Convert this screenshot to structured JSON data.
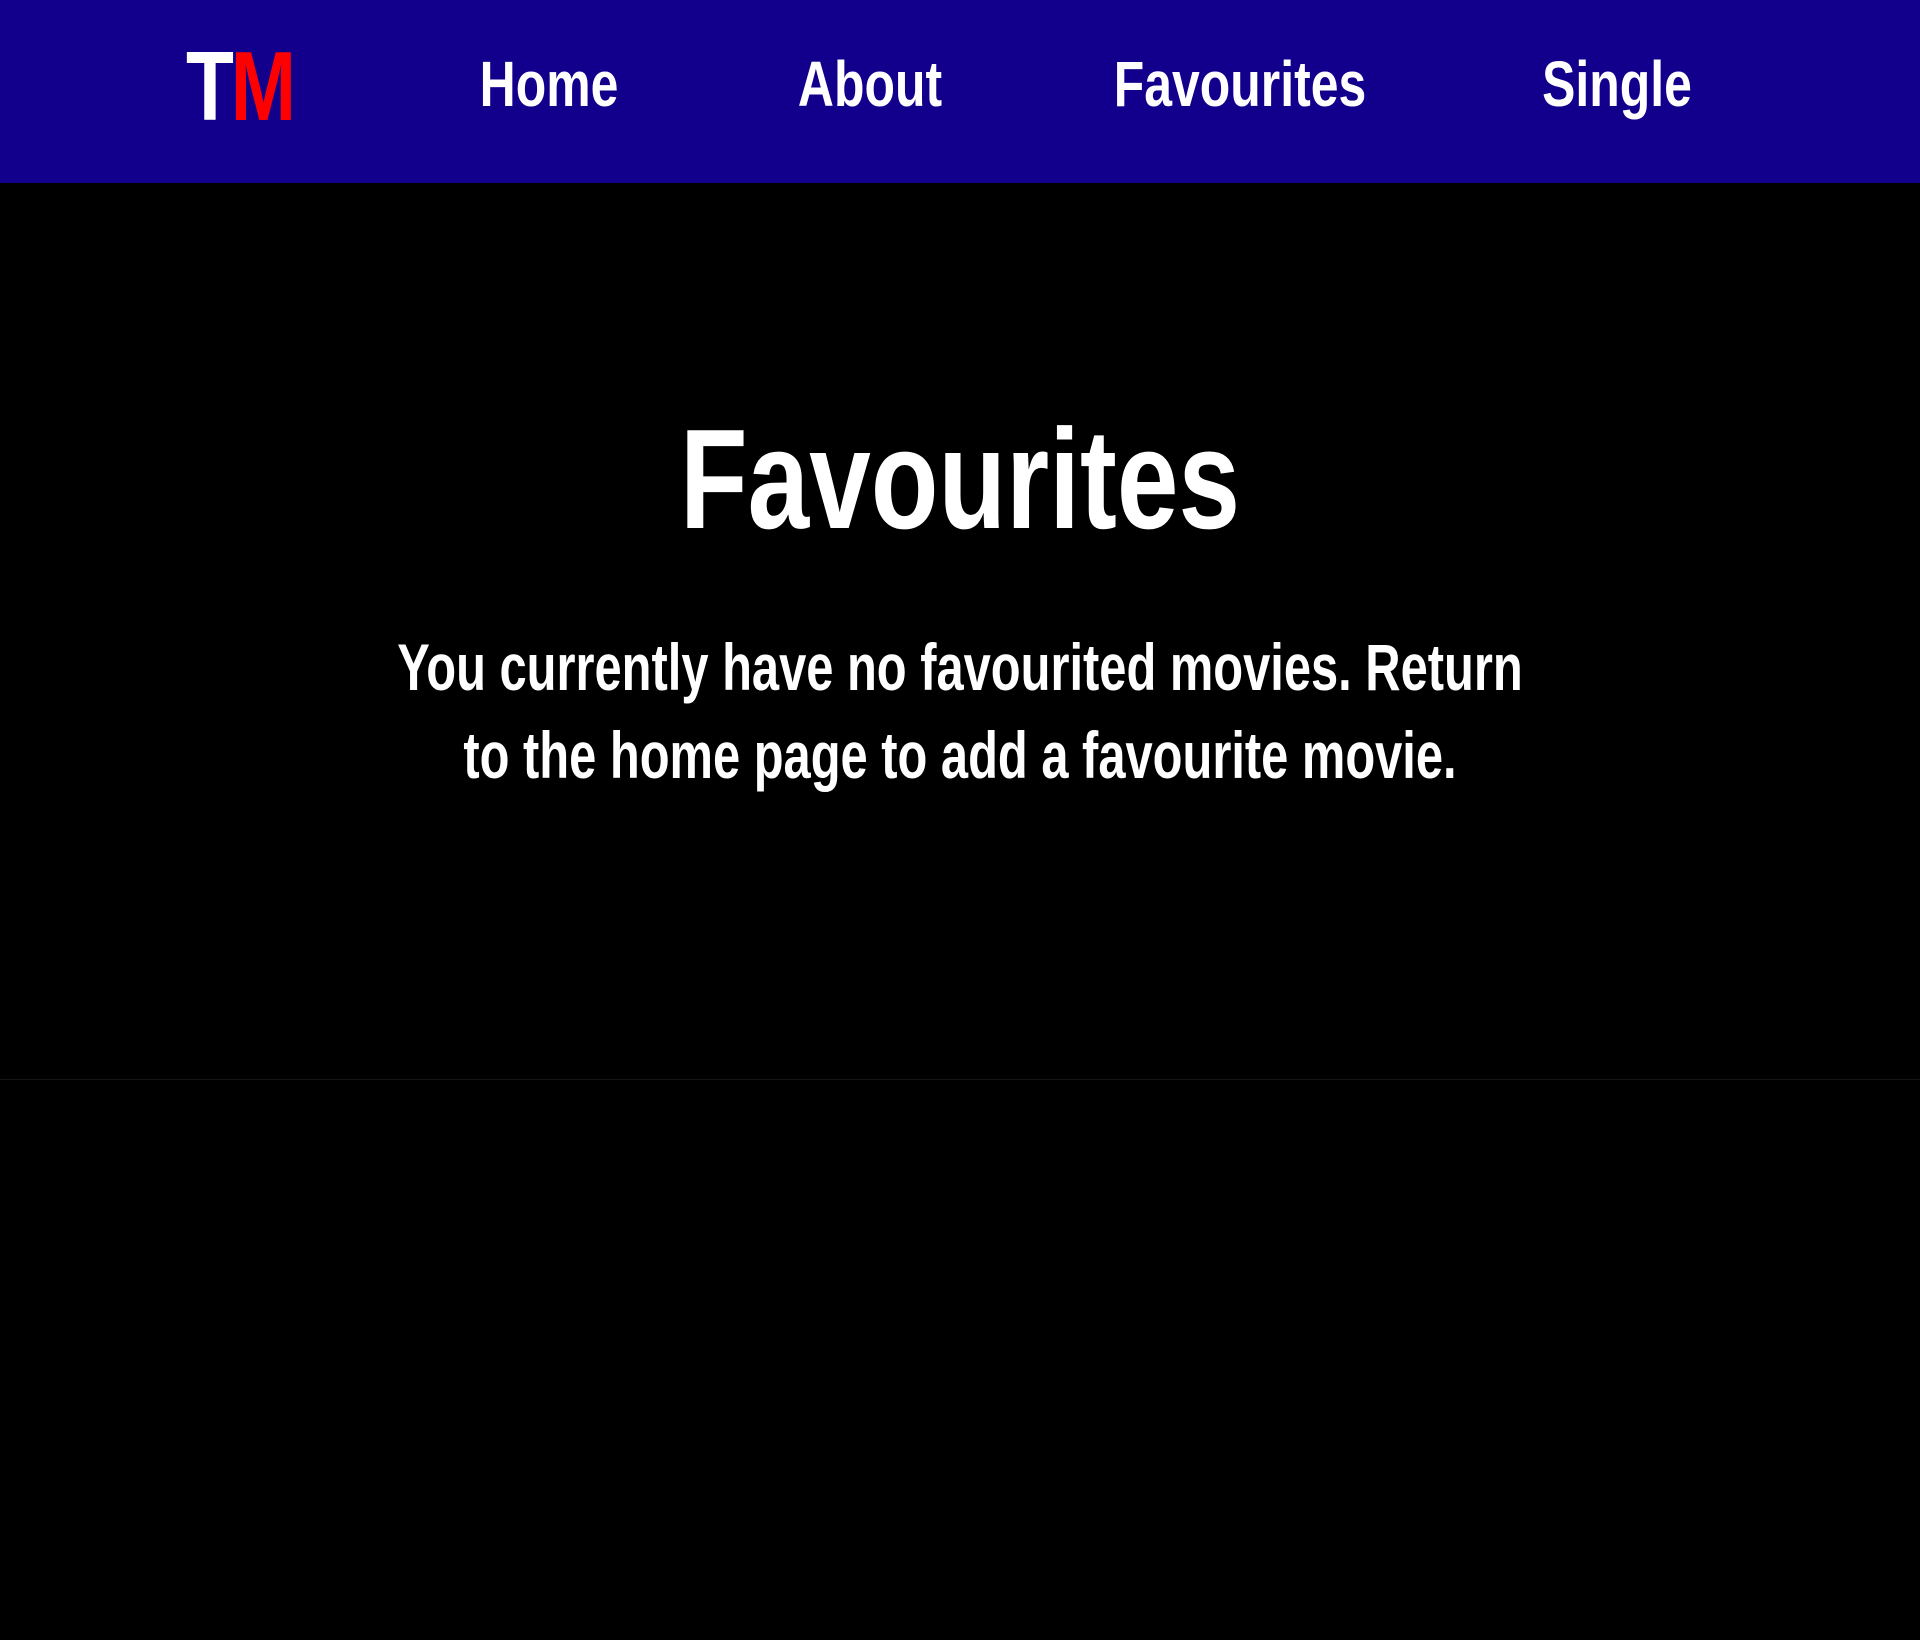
{
  "header": {
    "logo": {
      "first_letter": "T",
      "second_letter": "M",
      "first_color": "#ffffff",
      "second_color": "#ff0000"
    },
    "nav": {
      "home": "Home",
      "about": "About",
      "favourites": "Favourites",
      "single": "Single"
    },
    "background_color": "#12008c"
  },
  "main": {
    "title": "Favourites",
    "message": "You currently have no favourited movies. Return to the home page to add a favourite movie."
  }
}
